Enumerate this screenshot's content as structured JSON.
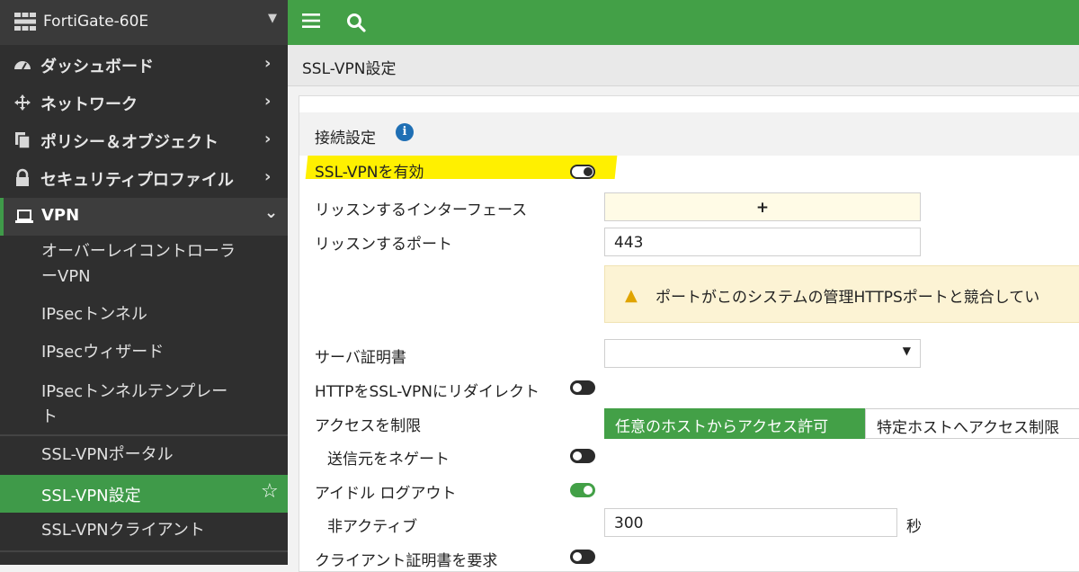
{
  "sidebar": {
    "device_name": "FortiGate-60E",
    "menu": [
      {
        "label": "ダッシュボード",
        "icon": "dashboard-icon"
      },
      {
        "label": "ネットワーク",
        "icon": "network-icon"
      },
      {
        "label": "ポリシー＆オブジェクト",
        "icon": "policy-icon"
      },
      {
        "label": "セキュリティプロファイル",
        "icon": "lock-icon"
      }
    ],
    "vpn": {
      "label": "VPN",
      "icon": "laptop-icon"
    },
    "vpn_items": [
      {
        "label_line1": "オーバーレイコントローラ",
        "label_line2": "ーVPN"
      },
      {
        "label_line1": "IPsecトンネル"
      },
      {
        "label_line1": "IPsecウィザード"
      },
      {
        "label_line1": "IPsecトンネルテンプレー",
        "label_line2": "ト"
      },
      {
        "label_line1": "SSL-VPNポータル"
      },
      {
        "label_line1": "SSL-VPN設定"
      },
      {
        "label_line1": "SSL-VPNクライアント"
      }
    ]
  },
  "page_title": "SSL-VPN設定",
  "section": {
    "title": "接続設定"
  },
  "form": {
    "enable_ssl_vpn": {
      "label": "SSL-VPNを有効",
      "state": "off"
    },
    "listen_interface": {
      "label": "リッスンするインターフェース",
      "add_button": "+"
    },
    "listen_port": {
      "label": "リッスンするポート",
      "value": "443"
    },
    "warning": {
      "text": "ポートがこのシステムの管理HTTPSポートと競合してい"
    },
    "server_cert": {
      "label": "サーバ証明書",
      "value": ""
    },
    "http_redirect": {
      "label": "HTTPをSSL-VPNにリダイレクト",
      "state": "off"
    },
    "restrict_access": {
      "label": "アクセスを制限",
      "options": [
        "任意のホストからアクセス許可",
        "特定ホストへアクセス制限"
      ],
      "selected": 0
    },
    "negate_source": {
      "label": "送信元をネゲート",
      "state": "off"
    },
    "idle_logout": {
      "label": "アイドル ログアウト",
      "state": "on"
    },
    "inactive": {
      "label": "非アクティブ",
      "value": "300",
      "unit": "秒"
    },
    "client_cert": {
      "label": "クライアント証明書を要求",
      "state": "off"
    }
  },
  "colors": {
    "accent": "#43a047",
    "sidebar": "#2f2f2f",
    "highlight": "#fff000",
    "warning_bg": "#fcf3d4"
  }
}
